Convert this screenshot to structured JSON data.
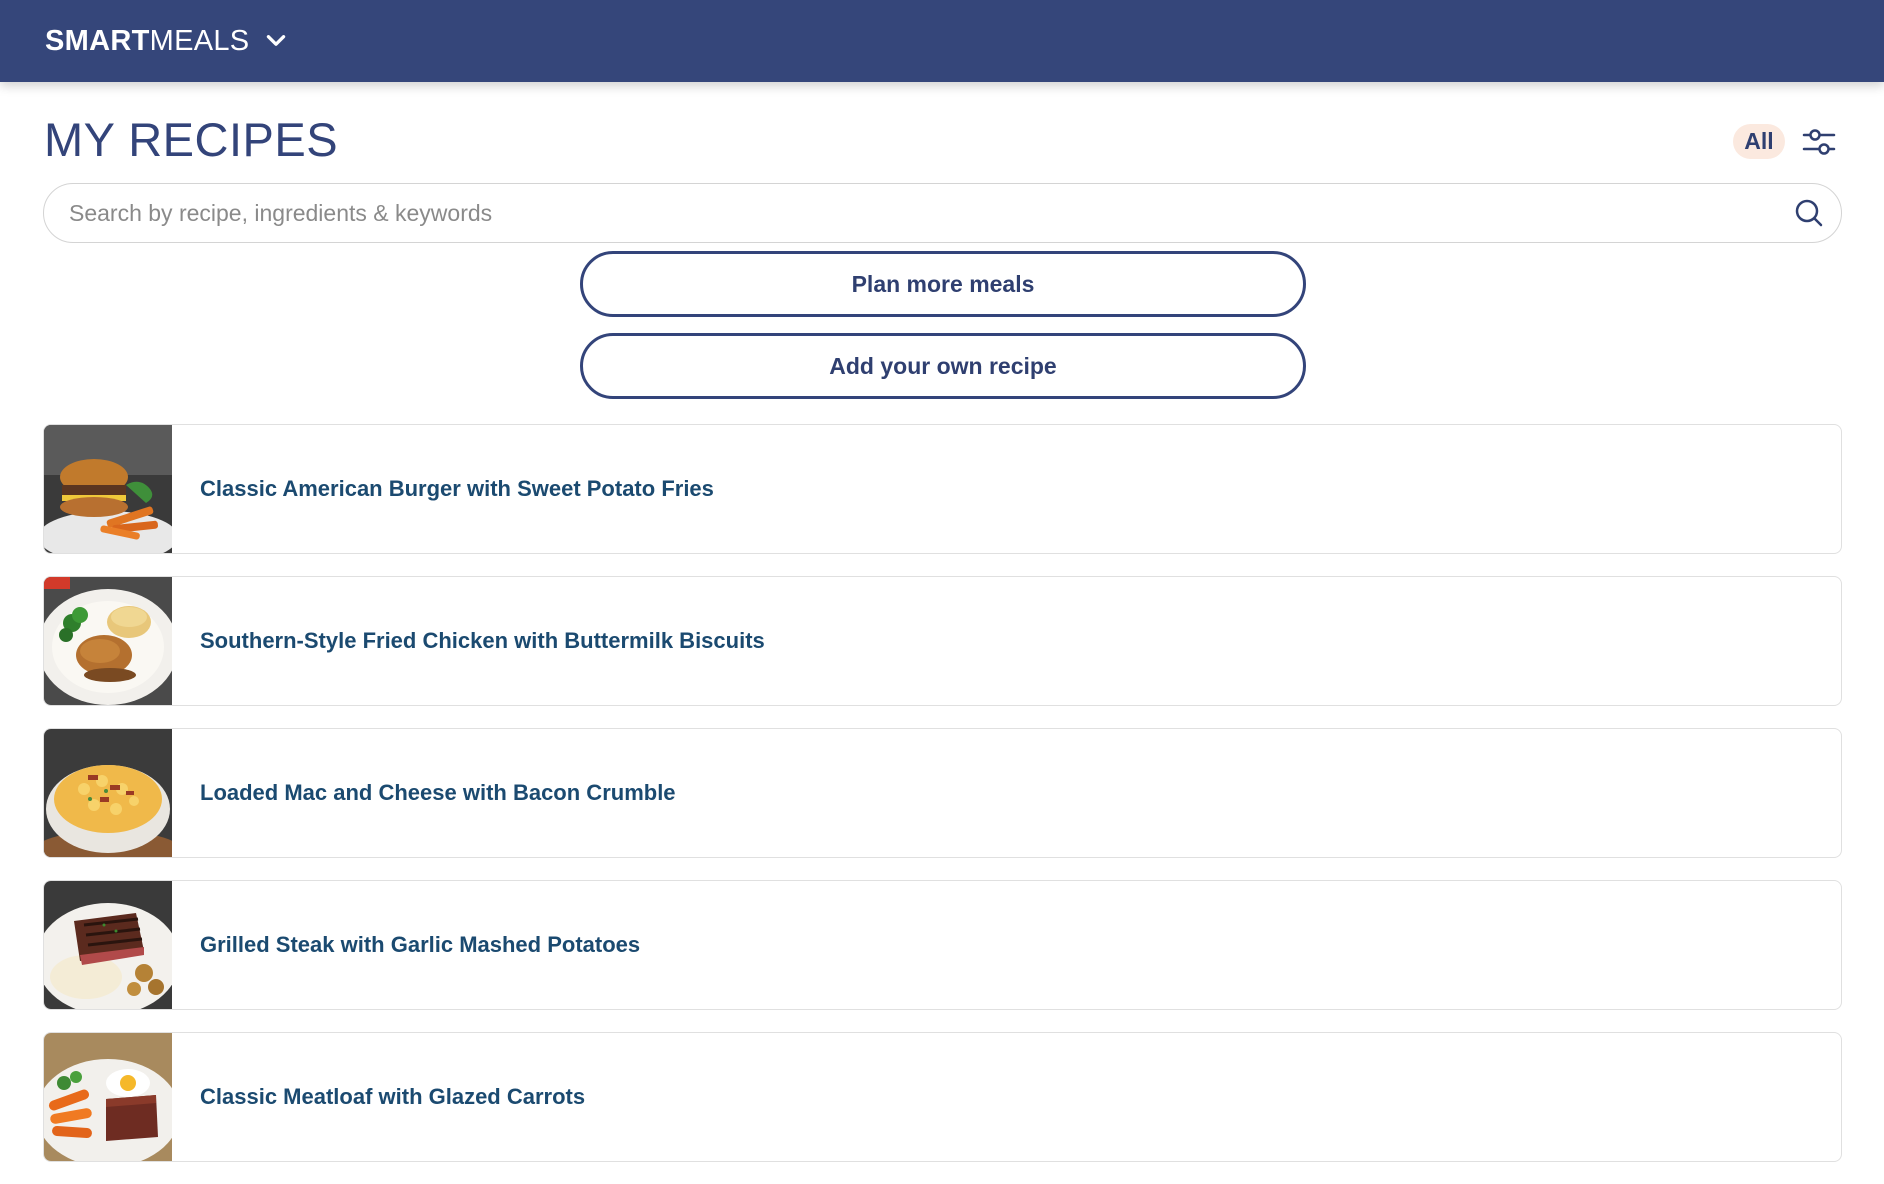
{
  "header": {
    "brand_bold": "SMART",
    "brand_light": "MEALS"
  },
  "page": {
    "title": "MY RECIPES"
  },
  "filter": {
    "label": "All"
  },
  "search": {
    "placeholder": "Search by recipe, ingredients & keywords",
    "value": ""
  },
  "actions": {
    "plan_label": "Plan more meals",
    "add_label": "Add your own recipe"
  },
  "recipes": [
    {
      "name": "Classic American Burger with Sweet Potato Fries"
    },
    {
      "name": "Southern-Style Fried Chicken with Buttermilk Biscuits"
    },
    {
      "name": "Loaded Mac and Cheese with Bacon Crumble"
    },
    {
      "name": "Grilled Steak with Garlic Mashed Potatoes"
    },
    {
      "name": "Classic Meatloaf with Glazed Carrots"
    }
  ],
  "colors": {
    "header_bg": "#35467a",
    "title": "#33447a",
    "recipe_text": "#1b4a70",
    "pill_bg": "#fbe9df"
  },
  "icons": {
    "brand_menu": "chevron-down-icon",
    "filter": "sliders-icon",
    "search": "search-icon"
  }
}
